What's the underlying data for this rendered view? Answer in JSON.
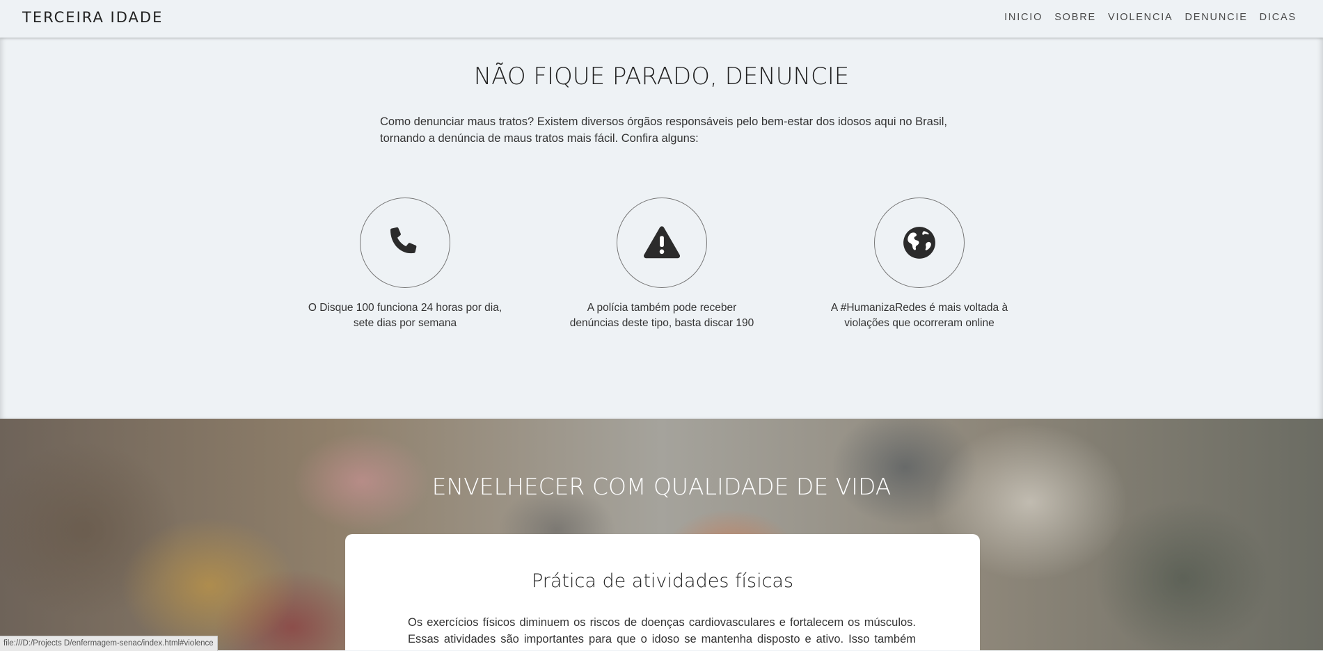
{
  "navbar": {
    "brand": "TERCEIRA IDADE",
    "links": [
      "INICIO",
      "SOBRE",
      "VIOLENCIA",
      "DENUNCIE",
      "DICAS"
    ]
  },
  "denuncie": {
    "title": "NÃO FIQUE PARADO, DENUNCIE",
    "intro": "Como denunciar maus tratos?  Existem diversos órgãos responsáveis pelo bem-estar dos idosos aqui no Brasil, tornando a denúncia de maus tratos mais fácil. Confira alguns:",
    "cards": [
      {
        "icon": "phone-icon",
        "text_line1": "O Disque 100 funciona 24 horas por dia,",
        "text_line2": "sete dias por semana"
      },
      {
        "icon": "warning-icon",
        "text_line1": "A polícia também pode receber",
        "text_line2": "denúncias deste tipo, basta discar 190"
      },
      {
        "icon": "globe-icon",
        "text_line1": "A #HumanizaRedes é mais voltada à",
        "text_line2": "violações que ocorreram online"
      }
    ]
  },
  "vida": {
    "title": "ENVELHECER COM QUALIDADE DE VIDA",
    "card_title": "Prática de atividades físicas",
    "card_text": "Os exercícios físicos diminuem os riscos de doenças cardiovasculares e fortalecem os músculos. Essas atividades são importantes para que o idoso se mantenha disposto e ativo. Isso também evita a"
  },
  "statusbar": {
    "url": "file:///D:/Projects D/enfermagem-senac/index.html#violence"
  },
  "colors": {
    "background": "#eef2f5",
    "icon": "#2b2b2b",
    "card": "#ffffff"
  }
}
